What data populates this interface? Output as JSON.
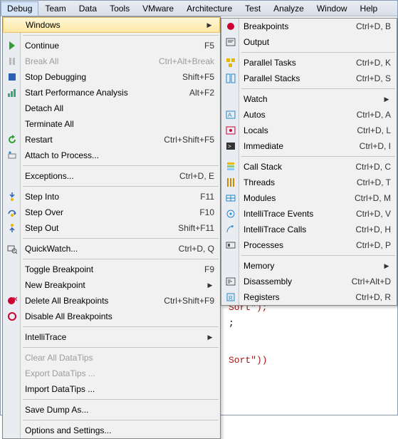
{
  "menubar": [
    "Debug",
    "Team",
    "Data",
    "Tools",
    "VMware",
    "Architecture",
    "Test",
    "Analyze",
    "Window",
    "Help"
  ],
  "debug": [
    {
      "t": "item",
      "hl": true,
      "label": "Windows",
      "sub": true,
      "icon": ""
    },
    {
      "t": "sep"
    },
    {
      "t": "item",
      "label": "Continue",
      "shortcut": "F5",
      "icon": "play"
    },
    {
      "t": "item",
      "label": "Break All",
      "shortcut": "Ctrl+Alt+Break",
      "disabled": true,
      "icon": "pause"
    },
    {
      "t": "item",
      "label": "Stop Debugging",
      "shortcut": "Shift+F5",
      "icon": "stop"
    },
    {
      "t": "item",
      "label": "Start Performance Analysis",
      "shortcut": "Alt+F2",
      "icon": "perf"
    },
    {
      "t": "item",
      "label": "Detach All"
    },
    {
      "t": "item",
      "label": "Terminate All"
    },
    {
      "t": "item",
      "label": "Restart",
      "shortcut": "Ctrl+Shift+F5",
      "icon": "restart"
    },
    {
      "t": "item",
      "label": "Attach to Process...",
      "icon": "attach"
    },
    {
      "t": "sep"
    },
    {
      "t": "item",
      "label": "Exceptions...",
      "shortcut": "Ctrl+D, E"
    },
    {
      "t": "sep"
    },
    {
      "t": "item",
      "label": "Step Into",
      "shortcut": "F11",
      "icon": "stepinto"
    },
    {
      "t": "item",
      "label": "Step Over",
      "shortcut": "F10",
      "icon": "stepover"
    },
    {
      "t": "item",
      "label": "Step Out",
      "shortcut": "Shift+F11",
      "icon": "stepout"
    },
    {
      "t": "sep"
    },
    {
      "t": "item",
      "label": "QuickWatch...",
      "shortcut": "Ctrl+D, Q",
      "icon": "quickwatch"
    },
    {
      "t": "sep"
    },
    {
      "t": "item",
      "label": "Toggle Breakpoint",
      "shortcut": "F9"
    },
    {
      "t": "item",
      "label": "New Breakpoint",
      "sub": true
    },
    {
      "t": "item",
      "label": "Delete All Breakpoints",
      "shortcut": "Ctrl+Shift+F9",
      "icon": "delbp"
    },
    {
      "t": "item",
      "label": "Disable All Breakpoints",
      "icon": "disbp"
    },
    {
      "t": "sep"
    },
    {
      "t": "item",
      "label": "IntelliTrace",
      "sub": true
    },
    {
      "t": "sep"
    },
    {
      "t": "item",
      "label": "Clear All DataTips",
      "disabled": true
    },
    {
      "t": "item",
      "label": "Export DataTips ...",
      "disabled": true
    },
    {
      "t": "item",
      "label": "Import DataTips ..."
    },
    {
      "t": "sep"
    },
    {
      "t": "item",
      "label": "Save Dump As..."
    },
    {
      "t": "sep"
    },
    {
      "t": "item",
      "label": "Options and Settings..."
    }
  ],
  "windows": [
    {
      "t": "item",
      "label": "Breakpoints",
      "shortcut": "Ctrl+D, B",
      "icon": "bp"
    },
    {
      "t": "item",
      "label": "Output",
      "icon": "output"
    },
    {
      "t": "sep"
    },
    {
      "t": "item",
      "label": "Parallel Tasks",
      "shortcut": "Ctrl+D, K",
      "icon": "ptask"
    },
    {
      "t": "item",
      "label": "Parallel Stacks",
      "shortcut": "Ctrl+D, S",
      "icon": "pstack"
    },
    {
      "t": "sep"
    },
    {
      "t": "item",
      "label": "Watch",
      "sub": true
    },
    {
      "t": "item",
      "label": "Autos",
      "shortcut": "Ctrl+D, A",
      "icon": "autos"
    },
    {
      "t": "item",
      "label": "Locals",
      "shortcut": "Ctrl+D, L",
      "icon": "locals"
    },
    {
      "t": "item",
      "label": "Immediate",
      "shortcut": "Ctrl+D, I",
      "icon": "immediate"
    },
    {
      "t": "sep"
    },
    {
      "t": "item",
      "label": "Call Stack",
      "shortcut": "Ctrl+D, C",
      "icon": "callstack"
    },
    {
      "t": "item",
      "label": "Threads",
      "shortcut": "Ctrl+D, T",
      "icon": "threads"
    },
    {
      "t": "item",
      "label": "Modules",
      "shortcut": "Ctrl+D, M",
      "icon": "modules"
    },
    {
      "t": "item",
      "label": "IntelliTrace Events",
      "shortcut": "Ctrl+D, V",
      "icon": "itevents"
    },
    {
      "t": "item",
      "label": "IntelliTrace Calls",
      "shortcut": "Ctrl+D, H",
      "icon": "itcalls"
    },
    {
      "t": "item",
      "label": "Processes",
      "shortcut": "Ctrl+D, P",
      "icon": "procs"
    },
    {
      "t": "sep"
    },
    {
      "t": "item",
      "label": "Memory",
      "sub": true
    },
    {
      "t": "item",
      "label": "Disassembly",
      "shortcut": "Ctrl+Alt+D",
      "icon": "disasm"
    },
    {
      "t": "item",
      "label": "Registers",
      "shortcut": "Ctrl+D, R",
      "icon": "regs"
    }
  ],
  "codebg": {
    "l1": "Sort\");",
    "l2": ";",
    "l3": "Sort\"))"
  }
}
